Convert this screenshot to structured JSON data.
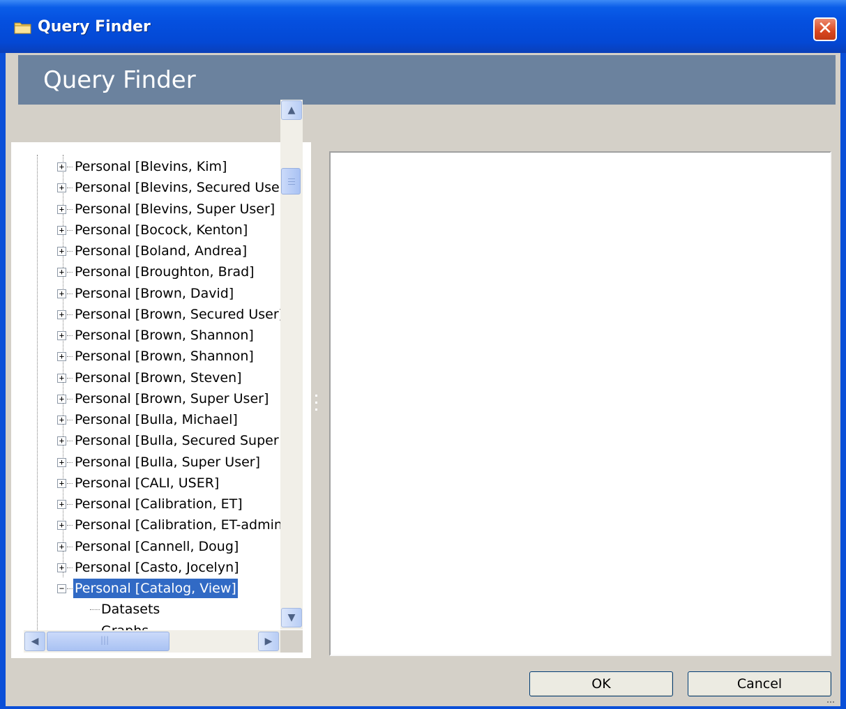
{
  "window": {
    "title": "Query Finder",
    "close_glyph": "✕"
  },
  "header": {
    "title": "Query Finder"
  },
  "tree": {
    "items": [
      {
        "label": "Personal [Blevins, Kim]",
        "expander": "+"
      },
      {
        "label": "Personal [Blevins, Secured User]",
        "expander": "+"
      },
      {
        "label": "Personal [Blevins, Super User]",
        "expander": "+"
      },
      {
        "label": "Personal [Bocock, Kenton]",
        "expander": "+"
      },
      {
        "label": "Personal [Boland, Andrea]",
        "expander": "+"
      },
      {
        "label": "Personal [Broughton, Brad]",
        "expander": "+"
      },
      {
        "label": "Personal [Brown, David]",
        "expander": "+"
      },
      {
        "label": "Personal [Brown, Secured User]",
        "expander": "+"
      },
      {
        "label": "Personal [Brown, Shannon]",
        "expander": "+"
      },
      {
        "label": "Personal [Brown, Shannon]",
        "expander": "+"
      },
      {
        "label": "Personal [Brown, Steven]",
        "expander": "+"
      },
      {
        "label": "Personal [Brown, Super User]",
        "expander": "+"
      },
      {
        "label": "Personal [Bulla, Michael]",
        "expander": "+"
      },
      {
        "label": "Personal [Bulla, Secured Super U",
        "expander": "+"
      },
      {
        "label": "Personal [Bulla, Super User]",
        "expander": "+"
      },
      {
        "label": "Personal [CALI, USER]",
        "expander": "+"
      },
      {
        "label": "Personal [Calibration, ET]",
        "expander": "+"
      },
      {
        "label": "Personal [Calibration, ET-admin]",
        "expander": "+"
      },
      {
        "label": "Personal [Cannell, Doug]",
        "expander": "+"
      },
      {
        "label": "Personal [Casto, Jocelyn]",
        "expander": "+"
      },
      {
        "label": "Personal [Catalog, View]",
        "expander": "−",
        "selected": true
      }
    ],
    "children": [
      {
        "label": "Datasets"
      },
      {
        "label": "Graphs"
      }
    ]
  },
  "scrollbar": {
    "up_glyph": "▲",
    "down_glyph": "▼",
    "left_glyph": "◀",
    "right_glyph": "▶",
    "grip_glyph": "|||"
  },
  "buttons": {
    "ok_label": "OK",
    "cancel_label": "Cancel"
  },
  "colors": {
    "titlebar": "#0550df",
    "header_banner": "#6b829e",
    "selection": "#316ac5",
    "dialog_bg": "#d4d0c8"
  }
}
